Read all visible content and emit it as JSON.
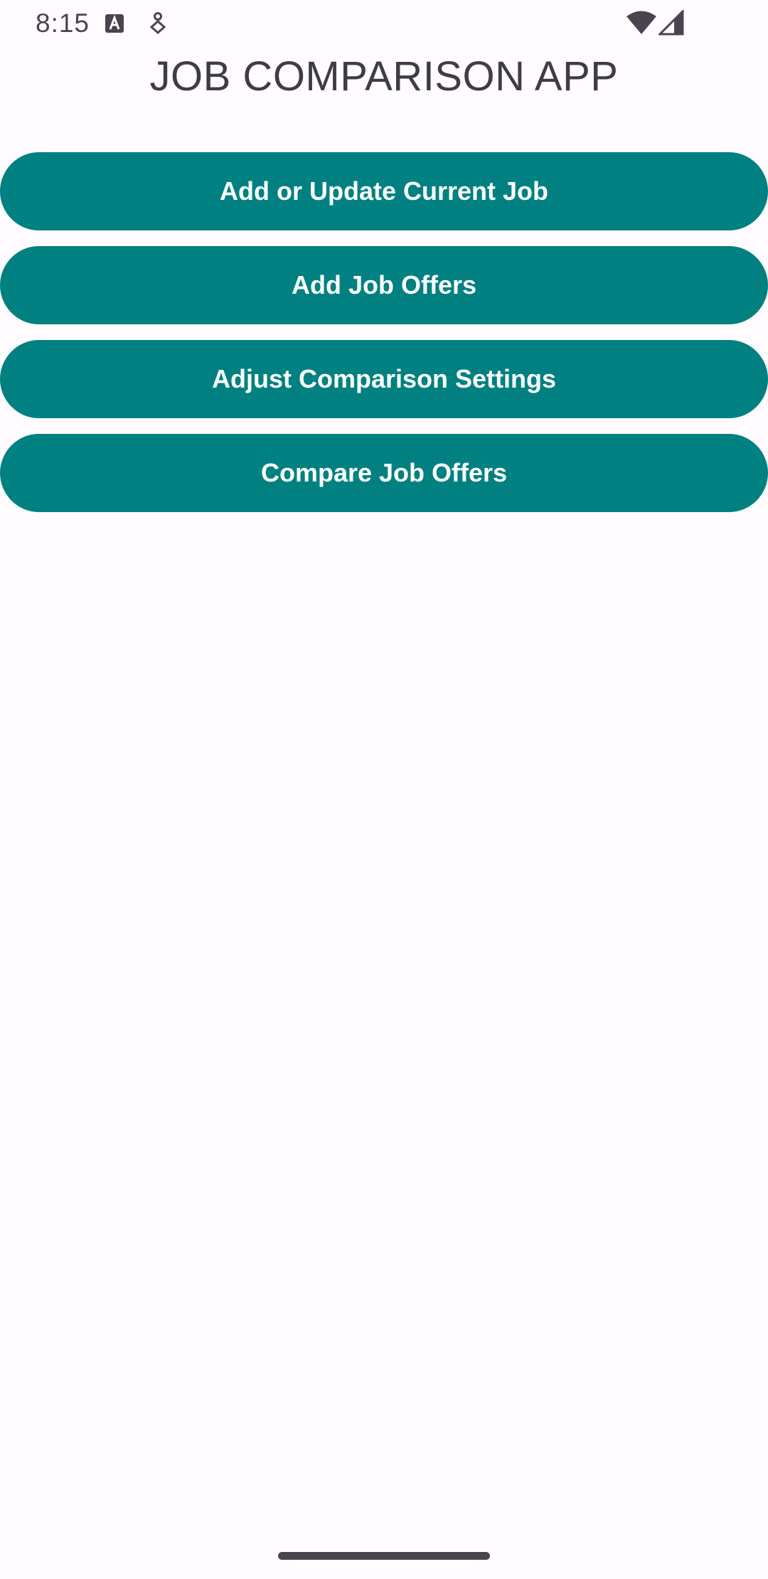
{
  "status_bar": {
    "time": "8:15",
    "icons": [
      "text-notification-icon",
      "location-assist-icon",
      "wifi-icon",
      "cell-signal-icon"
    ],
    "icon_color": "#49454f"
  },
  "app": {
    "title": "JOB COMPARISON APP"
  },
  "menu": {
    "buttons": [
      {
        "label": "Add or Update Current Job"
      },
      {
        "label": "Add Job Offers"
      },
      {
        "label": "Adjust Comparison Settings"
      },
      {
        "label": "Compare Job Offers"
      }
    ],
    "button_color": "#008080",
    "button_text_color": "#ffffff"
  },
  "nav": {
    "handle_icon": "gesture-nav-handle"
  },
  "colors": {
    "background": "#fffbfe",
    "accent": "#008080"
  }
}
